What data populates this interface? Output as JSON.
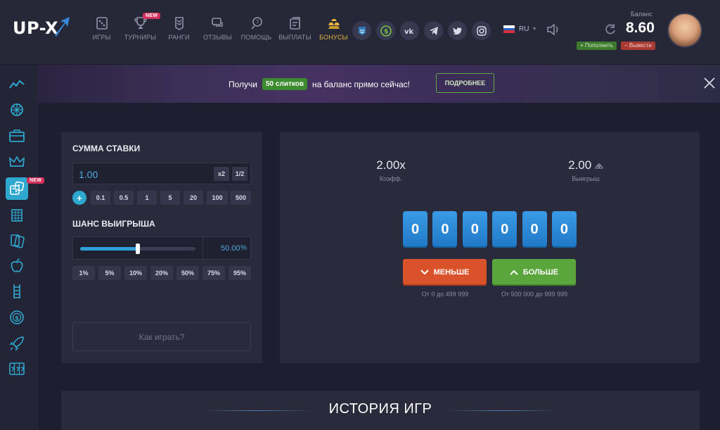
{
  "brand": {
    "logo_text": "UP-X"
  },
  "nav": [
    {
      "label": "ИГРЫ",
      "icon": "dice-icon"
    },
    {
      "label": "ТУРНИРЫ",
      "icon": "trophy-icon",
      "badge": "NEW"
    },
    {
      "label": "РАНГИ",
      "icon": "rank-icon"
    },
    {
      "label": "ОТЗЫВЫ",
      "icon": "chat-icon"
    },
    {
      "label": "ПОМОЩЬ",
      "icon": "help-icon"
    },
    {
      "label": "ВЫПЛАТЫ",
      "icon": "payout-icon"
    },
    {
      "label": "БОНУСЫ",
      "icon": "gold-bars-icon"
    }
  ],
  "socials": [
    "rank-shield-icon",
    "dollar-refresh-icon",
    "vk-icon",
    "telegram-icon",
    "twitter-icon",
    "instagram-icon"
  ],
  "language": {
    "code": "RU"
  },
  "balance": {
    "label": "Баланс",
    "value": "8.60",
    "deposit_label": "+ Пополнить",
    "withdraw_label": "− Вывести"
  },
  "sidebar": {
    "items": [
      "chart-line-icon",
      "wheel-icon",
      "case-icon",
      "crown-icon",
      "dice-icon",
      "tower-icon",
      "cards-icon",
      "apple-icon",
      "ladder-icon",
      "coin-icon",
      "rocket-icon",
      "slots-icon"
    ],
    "new_badge": "NEW"
  },
  "banner": {
    "text_before": "Получи",
    "highlight": "50 слитков",
    "text_after": "на баланс прямо сейчас!",
    "button_label": "ПОДРОБНЕЕ"
  },
  "bet": {
    "title": "СУММА СТАВКИ",
    "amount": "1.00",
    "double_label": "x2",
    "half_label": "1/2",
    "plus_label": "+",
    "quick_amounts": [
      "0.1",
      "0.5",
      "1",
      "5",
      "20",
      "100",
      "500"
    ]
  },
  "chance": {
    "title": "ШАНС ВЫИГРЫША",
    "value": "50.00",
    "unit": "%",
    "slider_fraction": 0.5,
    "presets": [
      "1%",
      "5%",
      "10%",
      "20%",
      "50%",
      "75%",
      "95%"
    ]
  },
  "howto_label": "Как играть?",
  "game": {
    "coef_value": "2.00x",
    "coef_label": "Коэфф.",
    "win_value": "2.00",
    "win_label": "Выигрыш",
    "digits": [
      "0",
      "0",
      "0",
      "0",
      "0",
      "0"
    ],
    "less_label": "МЕНЬШЕ",
    "more_label": "БОЛЬШЕ",
    "less_range": "От 0 до 499 999",
    "more_range": "От 500 000 до 999 999"
  },
  "history": {
    "title": "ИСТОРИЯ ИГР"
  },
  "colors": {
    "accent_blue": "#2fa8d0",
    "green": "#5aa53c",
    "orange": "#d9522a",
    "gold": "#e8b640",
    "badge_red": "#d8305c"
  }
}
